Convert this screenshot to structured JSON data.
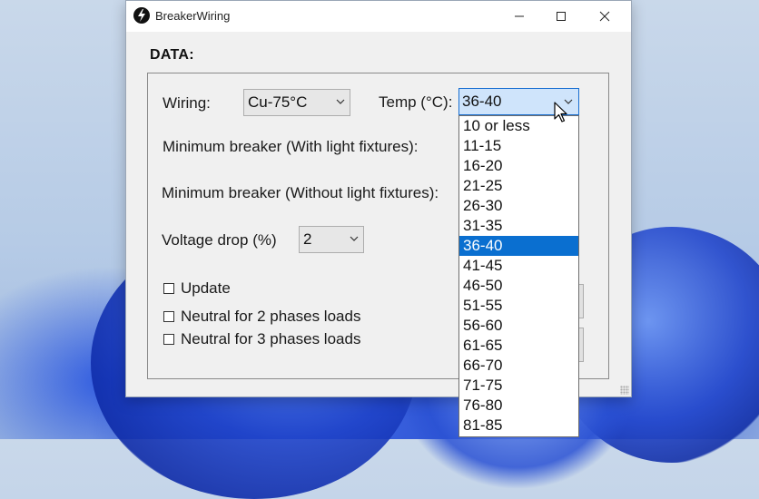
{
  "window": {
    "title": "BreakerWiring"
  },
  "section": {
    "title": "DATA:"
  },
  "wiring": {
    "label": "Wiring:",
    "value": "Cu-75°C"
  },
  "temp": {
    "label": "Temp (°C):",
    "value": "36-40",
    "options": [
      "10 or less",
      "11-15",
      "16-20",
      "21-25",
      "26-30",
      "31-35",
      "36-40",
      "41-45",
      "46-50",
      "51-55",
      "56-60",
      "61-65",
      "66-70",
      "71-75",
      "76-80",
      "81-85"
    ],
    "selected_index": 6
  },
  "min_breaker_light": {
    "label": "Minimum breaker (With light fixtures):"
  },
  "min_breaker_no_light": {
    "label": "Minimum breaker (Without light fixtures):"
  },
  "voltage_drop": {
    "label": "Voltage drop (%)",
    "value": "2"
  },
  "checkboxes": {
    "update": "Update",
    "neutral2": "Neutral for 2 phases loads",
    "neutral3": "Neutral for 3 phases loads"
  },
  "colors": {
    "accent": "#0a6fd0",
    "focus_bg": "#cfe4fb"
  }
}
